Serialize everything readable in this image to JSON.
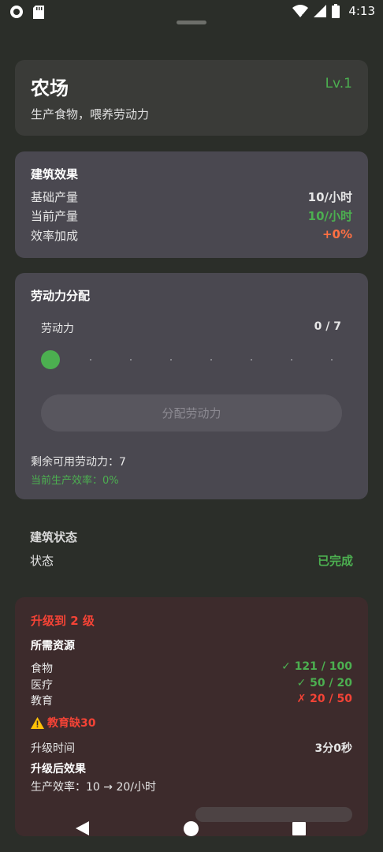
{
  "status_bar": {
    "time": "4:13",
    "icons": [
      "record-icon",
      "sd-card-icon",
      "wifi-icon",
      "signal-icon",
      "battery-icon"
    ]
  },
  "header": {
    "title": "农场",
    "level": "Lv.1",
    "subtitle": "生产食物，喂养劳动力"
  },
  "effects": {
    "title": "建筑效果",
    "rows": [
      {
        "label": "基础产量",
        "value": "10/小时",
        "color": "#e6e6e6"
      },
      {
        "label": "当前产量",
        "value": "10/小时",
        "color": "#4caf50"
      },
      {
        "label": "效率加成",
        "value": "+0%",
        "color": "#ff7043"
      }
    ]
  },
  "labor": {
    "title": "劳动力分配",
    "label": "劳动力",
    "count": "0 / 7",
    "slider_value": 0,
    "slider_max": 7,
    "assign_button": "分配劳动力",
    "remaining": "剩余可用劳动力：7",
    "efficiency": "当前生产效率：0%"
  },
  "status": {
    "title": "建筑状态",
    "label": "状态",
    "value": "已完成"
  },
  "upgrade": {
    "title": "升级到 2 级",
    "resources_title": "所需资源",
    "resources": [
      {
        "name": "食物",
        "mark": "✓",
        "amount": "121 / 100",
        "color": "#4caf50"
      },
      {
        "name": "医疗",
        "mark": "✓",
        "amount": "50 / 20",
        "color": "#4caf50"
      },
      {
        "name": "教育",
        "mark": "✗",
        "amount": "20 / 50",
        "color": "#f44336"
      }
    ],
    "warning": "教育缺30",
    "time_label": "升级时间",
    "time_value": "3分0秒",
    "after_title": "升级后效果",
    "after_text": "生产效率：10 → 20/小时"
  },
  "colors": {
    "accent_green": "#4caf50",
    "error_red": "#f44336",
    "orange": "#ff7043"
  }
}
